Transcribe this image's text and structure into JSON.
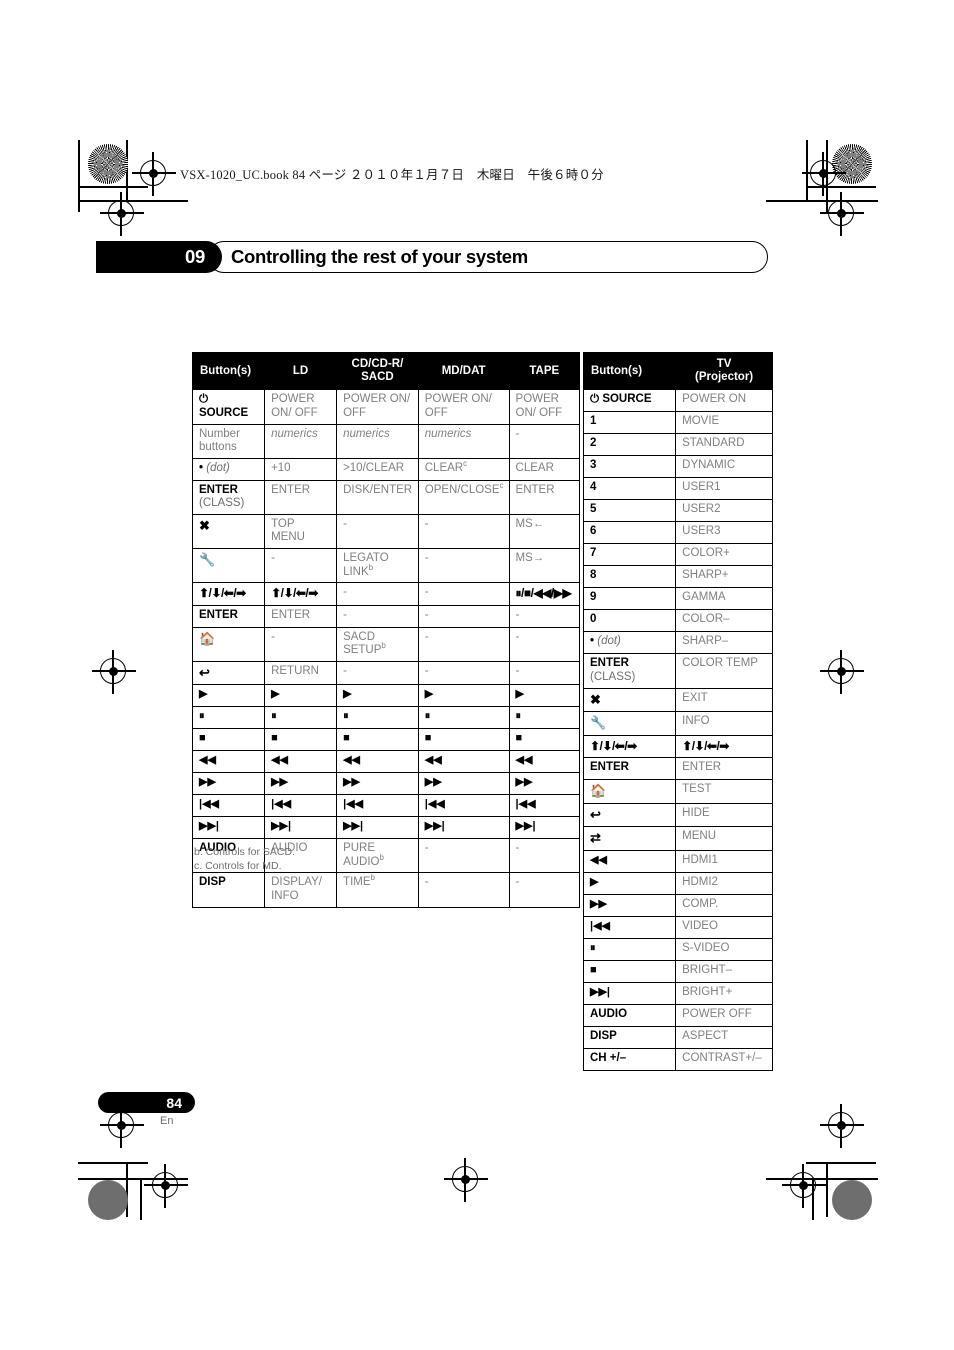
{
  "page": {
    "book_line": "VSX-1020_UC.book   84 ページ   ２０１０年１月７日　木曜日　午後６時０分",
    "chapter_number": "09",
    "chapter_title": "Controlling the rest of your system",
    "page_number": "84",
    "language_code": "En"
  },
  "left_table": {
    "headers": [
      "Button(s)",
      "LD",
      "CD/CD-R/\nSACD",
      "MD/DAT",
      "TAPE"
    ],
    "header_cd": "CD/CD-R/",
    "header_cd2": "SACD",
    "rows": [
      {
        "button": "SOURCE",
        "button_icon": "power-icon",
        "ld": "POWER ON/ OFF",
        "cd": "POWER ON/ OFF",
        "md": "POWER ON/ OFF",
        "tape": "POWER ON/ OFF"
      },
      {
        "button": "Number buttons",
        "button_style": "gray",
        "ld": "numerics",
        "cd": "numerics",
        "md": "numerics",
        "tape": "-",
        "italic": true
      },
      {
        "button": "(dot)",
        "button_prefix": "•",
        "button_style": "dot",
        "ld": "+10",
        "cd": ">10/CLEAR",
        "md": "CLEAR",
        "md_sup": "c",
        "tape": "CLEAR"
      },
      {
        "button": "ENTER",
        "button_sub": "(CLASS)",
        "ld": "ENTER",
        "cd": "DISK/ENTER",
        "md": "OPEN/CLOSE",
        "md_sup": "c",
        "tape": "ENTER"
      },
      {
        "button_icon": "close-x-icon",
        "ld": "TOP MENU",
        "cd": "-",
        "md": "-",
        "tape": "MS←"
      },
      {
        "button_icon": "wrench-icon",
        "ld": "-",
        "cd": "LEGATO LINK",
        "cd_sup": "b",
        "md": "-",
        "tape": "MS→"
      },
      {
        "button_icon": "dpad-arrows-icon",
        "ld_icon": "dpad-arrows-icon",
        "cd": "-",
        "md": "-",
        "tape_icon": "pause-stop-rew-ff-icon"
      },
      {
        "button": "ENTER",
        "ld": "ENTER",
        "cd": "-",
        "md": "-",
        "tape": "-"
      },
      {
        "button_icon": "home-icon",
        "ld": "-",
        "cd": "SACD SETUP",
        "cd_sup": "b",
        "md": "-",
        "tape": "-"
      },
      {
        "button_icon": "return-icon",
        "ld": "RETURN",
        "cd": "-",
        "md": "-",
        "tape": "-"
      },
      {
        "button_icon": "play-icon",
        "ld_icon": "play-icon",
        "cd_icon": "play-icon",
        "md_icon": "play-icon",
        "tape_icon": "play-icon"
      },
      {
        "button_icon": "pause-icon",
        "ld_icon": "pause-icon",
        "cd_icon": "pause-icon",
        "md_icon": "pause-icon",
        "tape_icon": "pause-icon"
      },
      {
        "button_icon": "stop-icon",
        "ld_icon": "stop-icon",
        "cd_icon": "stop-icon",
        "md_icon": "stop-icon",
        "tape_icon": "stop-icon"
      },
      {
        "button_icon": "rewind-icon",
        "ld_icon": "rewind-icon",
        "cd_icon": "rewind-icon",
        "md_icon": "rewind-icon",
        "tape_icon": "rewind-icon"
      },
      {
        "button_icon": "fast-forward-icon",
        "ld_icon": "fast-forward-icon",
        "cd_icon": "fast-forward-icon",
        "md_icon": "fast-forward-icon",
        "tape_icon": "fast-forward-icon"
      },
      {
        "button_icon": "previous-track-icon",
        "ld_icon": "previous-track-icon",
        "cd_icon": "previous-track-icon",
        "md_icon": "previous-track-icon",
        "tape_icon": "previous-track-icon"
      },
      {
        "button_icon": "next-track-icon",
        "ld_icon": "next-track-icon",
        "cd_icon": "next-track-icon",
        "md_icon": "next-track-icon",
        "tape_icon": "next-track-icon"
      },
      {
        "button": "AUDIO",
        "ld": "AUDIO",
        "cd": "PURE AUDIO",
        "cd_sup": "b",
        "md": "-",
        "tape": "-"
      },
      {
        "button": "DISP",
        "ld": "DISPLAY/ INFO",
        "cd": "TIME",
        "cd_sup": "b",
        "md": "-",
        "tape": "-"
      }
    ],
    "footnotes": [
      "b. Controls for SACD.",
      "c. Controls for MD."
    ]
  },
  "right_table": {
    "headers": [
      "Button(s)",
      "TV\n(Projector)"
    ],
    "header_tv": "TV",
    "header_tv2": "(Projector)",
    "rows": [
      {
        "button": "SOURCE",
        "button_icon": "power-icon",
        "tv": "POWER ON"
      },
      {
        "button": "1",
        "tv": "MOVIE"
      },
      {
        "button": "2",
        "tv": "STANDARD"
      },
      {
        "button": "3",
        "tv": "DYNAMIC"
      },
      {
        "button": "4",
        "tv": "USER1"
      },
      {
        "button": "5",
        "tv": "USER2"
      },
      {
        "button": "6",
        "tv": "USER3"
      },
      {
        "button": "7",
        "tv": "COLOR+"
      },
      {
        "button": "8",
        "tv": "SHARP+"
      },
      {
        "button": "9",
        "tv": "GAMMA"
      },
      {
        "button": "0",
        "tv": "COLOR–"
      },
      {
        "button": "(dot)",
        "button_prefix": "•",
        "button_style": "dot",
        "tv": "SHARP–"
      },
      {
        "button": "ENTER",
        "button_inline": "(CLASS)",
        "tv": "COLOR TEMP"
      },
      {
        "button_icon": "close-x-icon",
        "tv": "EXIT"
      },
      {
        "button_icon": "wrench-icon",
        "tv": "INFO"
      },
      {
        "button_icon": "dpad-arrows-icon",
        "tv_icon": "dpad-arrows-icon"
      },
      {
        "button": "ENTER",
        "tv": "ENTER"
      },
      {
        "button_icon": "home-icon",
        "tv": "TEST"
      },
      {
        "button_icon": "return-icon",
        "tv": "HIDE"
      },
      {
        "button_icon": "shuffle-icon",
        "tv": "MENU"
      },
      {
        "button_icon": "rewind-icon",
        "tv": "HDMI1"
      },
      {
        "button_icon": "play-icon",
        "tv": "HDMI2"
      },
      {
        "button_icon": "fast-forward-icon",
        "tv": "COMP."
      },
      {
        "button_icon": "previous-track-icon",
        "tv": "VIDEO"
      },
      {
        "button_icon": "pause-icon",
        "tv": "S-VIDEO"
      },
      {
        "button_icon": "stop-icon",
        "tv": "BRIGHT–"
      },
      {
        "button_icon": "next-track-icon",
        "tv": "BRIGHT+"
      },
      {
        "button": "AUDIO",
        "tv": "POWER OFF"
      },
      {
        "button": "DISP",
        "tv": "ASPECT"
      },
      {
        "button": "CH +/–",
        "tv": "CONTRAST+/–"
      }
    ]
  },
  "colors": {
    "text_gray": "#807f83",
    "black": "#000000",
    "white": "#ffffff"
  }
}
